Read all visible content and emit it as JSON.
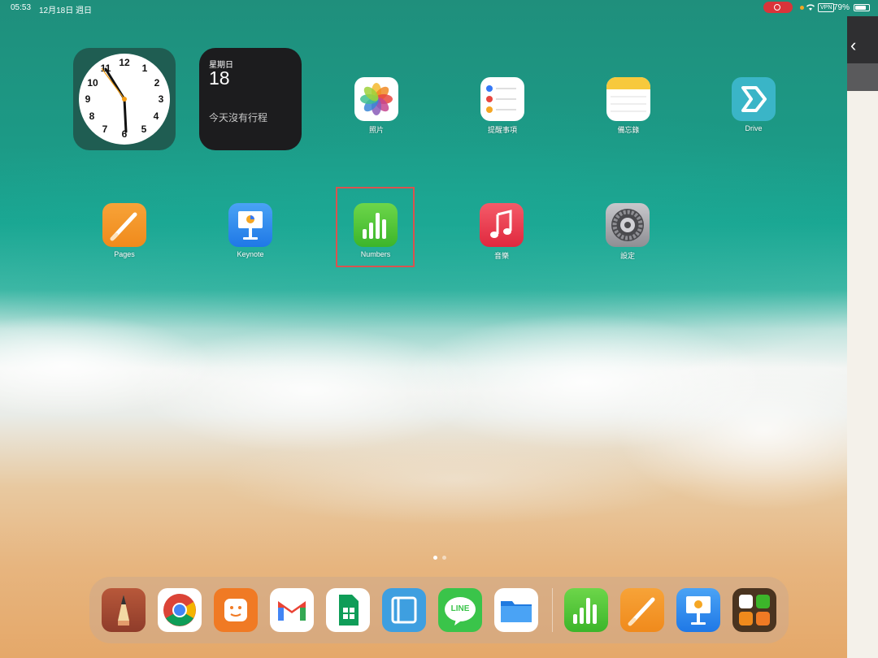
{
  "status_bar": {
    "time": "05:53",
    "date": "12月18日 週日",
    "vpn": "VPN",
    "battery": "79%"
  },
  "widgets": {
    "calendar": {
      "weekday": "星期日",
      "day": "18",
      "no_events": "今天沒有行程"
    },
    "clock": {
      "numbers": [
        "12",
        "1",
        "2",
        "3",
        "4",
        "5",
        "6",
        "7",
        "8",
        "9",
        "10",
        "11"
      ]
    }
  },
  "apps": {
    "photos": "照片",
    "reminders": "提醒事項",
    "notes": "備忘錄",
    "drive": "Drive",
    "pages": "Pages",
    "keynote": "Keynote",
    "numbers": "Numbers",
    "music": "音樂",
    "settings": "設定"
  },
  "dock": {
    "apps": [
      "pencil-planner-icon",
      "chrome-icon",
      "power-app-icon",
      "gmail-icon",
      "google-sheets-icon",
      "wallet-book-icon",
      "line-icon",
      "files-icon",
      "numbers-icon",
      "pages-icon",
      "keynote-icon",
      "app-library-icon"
    ],
    "line_text": "LINE"
  },
  "colors": {
    "highlight": "#d9534f",
    "record": "#d9343a",
    "calendar_bg": "#1c1c1e"
  }
}
